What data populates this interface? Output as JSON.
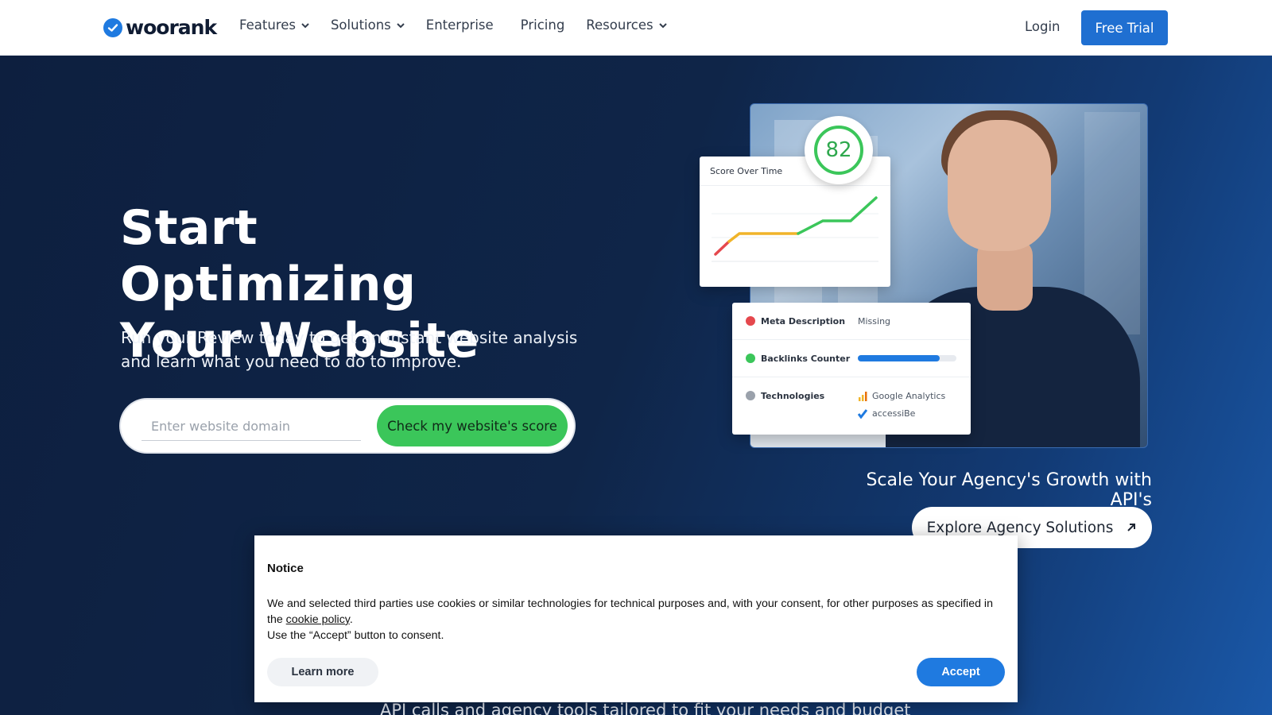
{
  "header": {
    "logo_text": "woorank",
    "nav": [
      {
        "label": "Features",
        "has_dropdown": true
      },
      {
        "label": "Solutions",
        "has_dropdown": true
      },
      {
        "label": "Enterprise",
        "has_dropdown": false
      },
      {
        "label": "Pricing",
        "has_dropdown": false
      },
      {
        "label": "Resources",
        "has_dropdown": true
      }
    ],
    "login_label": "Login",
    "free_trial_label": "Free Trial"
  },
  "hero": {
    "headline_line1": "Start Optimizing",
    "headline_line2": "Your Website",
    "subline": "Run your Review today to get an instant website analysis and learn what you need to do to improve.",
    "search_placeholder": "Enter website domain",
    "check_button_label": "Check my website's score"
  },
  "visual": {
    "score_value": "82",
    "score_card_title": "Score Over Time",
    "audit_rows": [
      {
        "label": "Meta Description",
        "value": "Missing",
        "status_color": "#e5484d"
      },
      {
        "label": "Backlinks Counter",
        "progress": 0.83,
        "status_color": "#3bc65a"
      },
      {
        "label": "Technologies",
        "status_color": "#9aa1ab",
        "techs": [
          "Google Analytics",
          "accessiBe"
        ]
      }
    ]
  },
  "agency": {
    "tagline": "Scale Your Agency's Growth with API's",
    "button_label": "Explore Agency Solutions"
  },
  "partial_text": "API calls and agency tools tailored to fit your needs and budget",
  "notice": {
    "title": "Notice",
    "text_before_link": "We and selected third parties use cookies or similar technologies for technical purposes and, with your consent, for other purposes as specified in the ",
    "link_text": "cookie policy",
    "text_after_link": ".",
    "text_line2": "Use the “Accept” button to consent.",
    "learn_more_label": "Learn more",
    "accept_label": "Accept"
  },
  "colors": {
    "brand_blue": "#1f6fd1",
    "cta_green": "#3bc65a",
    "hero_bg": "#0f2546"
  }
}
